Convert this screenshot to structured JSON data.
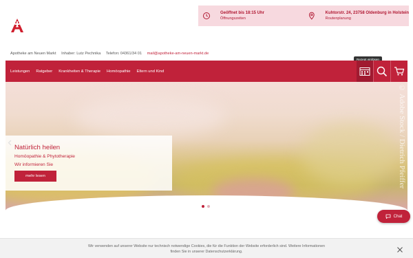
{
  "header": {
    "opening": {
      "title": "Geöffnet bis 18:15 Uhr",
      "sub": "Öffnungszeiten"
    },
    "address": {
      "title": "Kuhtorstr. 24, 23758 Oldenburg in Holstein",
      "sub": "Routenplanung"
    }
  },
  "contact": {
    "name": "Apotheke am Neuen Markt",
    "owner": "Inhaber: Lutz Pechnika",
    "phone": "Telefon: 04361/34 01",
    "email": "mail@apotheke-am-neuen-markt.de"
  },
  "nav": {
    "items": [
      {
        "label": "Leistungen"
      },
      {
        "label": "Ratgeber"
      },
      {
        "label": "Krankheiten & Therapie"
      },
      {
        "label": "Homöopathie"
      },
      {
        "label": "Eltern und Kind"
      }
    ],
    "tooltip": "Rezept einlösen"
  },
  "hero": {
    "title": "Natürlich heilen",
    "subtitle": "Homöopathie & Phytotherapie",
    "subtitle2": "Wir informieren Sie",
    "button_label": "mehr lesen",
    "vertical_text": "© Adobe Stock / Dietrich Pfeiffer"
  },
  "chat": {
    "label": "Chat"
  },
  "cookie": {
    "text_line1": "Wir verwenden auf unserer Website nur technisch notwendige Cookies, die für die Funktion der Website erforderlich sind. Weitere Informationen",
    "text_line2": "finden Sie in unserer Datenschutzerklärung."
  },
  "colors": {
    "brand": "#c0223a",
    "info_bg": "#f7d9df",
    "cookie_bg": "#f2f2f2"
  },
  "icons": {
    "logo": "apotheke-a-logo",
    "clock": "clock-icon",
    "location": "location-pin-icon",
    "prescription": "prescription-icon",
    "search": "search-icon",
    "cart": "cart-icon",
    "chat": "chat-bubble-icon",
    "close": "close-icon",
    "arrow": "chevron-left-icon"
  }
}
